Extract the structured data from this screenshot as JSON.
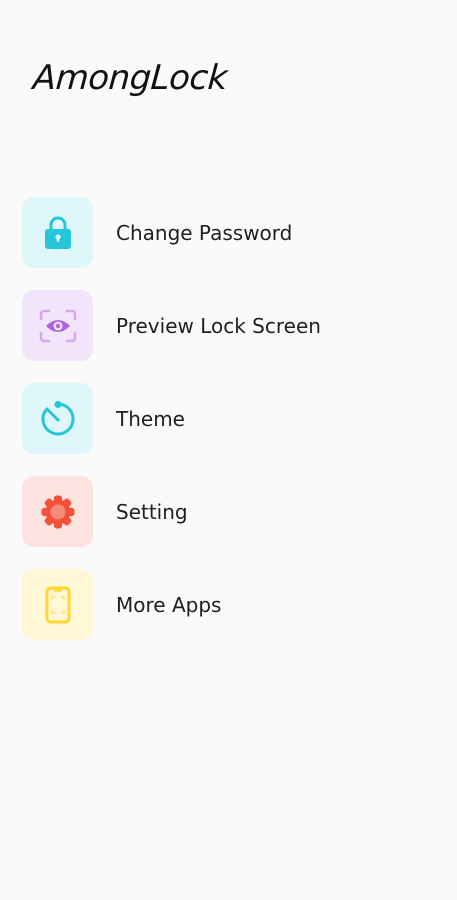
{
  "header": {
    "app_name": "AmongLock"
  },
  "menu": {
    "items": [
      {
        "label": "Change Password",
        "icon": "lock-icon",
        "tile_color": "#dff6fa",
        "icon_color": "#26c6da"
      },
      {
        "label": "Preview Lock Screen",
        "icon": "eye-scan-icon",
        "tile_color": "#f2e4fb",
        "icon_color": "#b062e0"
      },
      {
        "label": "Theme",
        "icon": "timer-icon",
        "tile_color": "#dff6fa",
        "icon_color": "#26c6da"
      },
      {
        "label": "Setting",
        "icon": "gear-icon",
        "tile_color": "#fde3df",
        "icon_color": "#f4513c"
      },
      {
        "label": "More Apps",
        "icon": "phone-icon",
        "tile_color": "#fff7d6",
        "icon_color": "#fdd835"
      }
    ]
  }
}
